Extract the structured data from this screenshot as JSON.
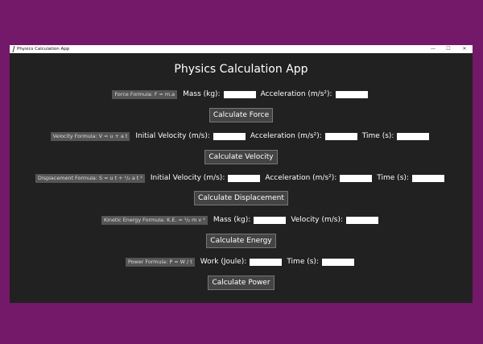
{
  "window": {
    "title": "Physics Calculation App",
    "controls": {
      "minimize": "—",
      "maximize": "☐",
      "close": "✕"
    }
  },
  "app_title": "Physics Calculation App",
  "sections": {
    "force": {
      "formula": "Force Formula: F = m.a",
      "mass_label": "Mass (kg):",
      "accel_label": "Acceleration (m/s²):",
      "button": "Calculate Force"
    },
    "velocity": {
      "formula": "Velocity Formula: V = u + a t",
      "init_label": "Initial Velocity (m/s):",
      "accel_label": "Acceleration (m/s²):",
      "time_label": "Time (s):",
      "button": "Calculate Velocity"
    },
    "displacement": {
      "formula": "Displacement Formula: S = u t + ¹/₂ a t ²",
      "init_label": "Initial Velocity (m/s):",
      "accel_label": "Acceleration (m/s²):",
      "time_label": "Time (s):",
      "button": "Calculate Displacement"
    },
    "energy": {
      "formula": "Kinetic Energy Formula: K.E. = ¹/₂ m v ²",
      "mass_label": "Mass (kg):",
      "velocity_label": "Velocity (m/s):",
      "button": "Calculate Energy"
    },
    "power": {
      "formula": "Power Formula: P = W / t",
      "work_label": "Work (Joule):",
      "time_label": "Time (s):",
      "button": "Calculate Power"
    }
  },
  "colors": {
    "background": "#741869",
    "window": "#212121",
    "formula_label": "#555555",
    "button": "#444444"
  }
}
